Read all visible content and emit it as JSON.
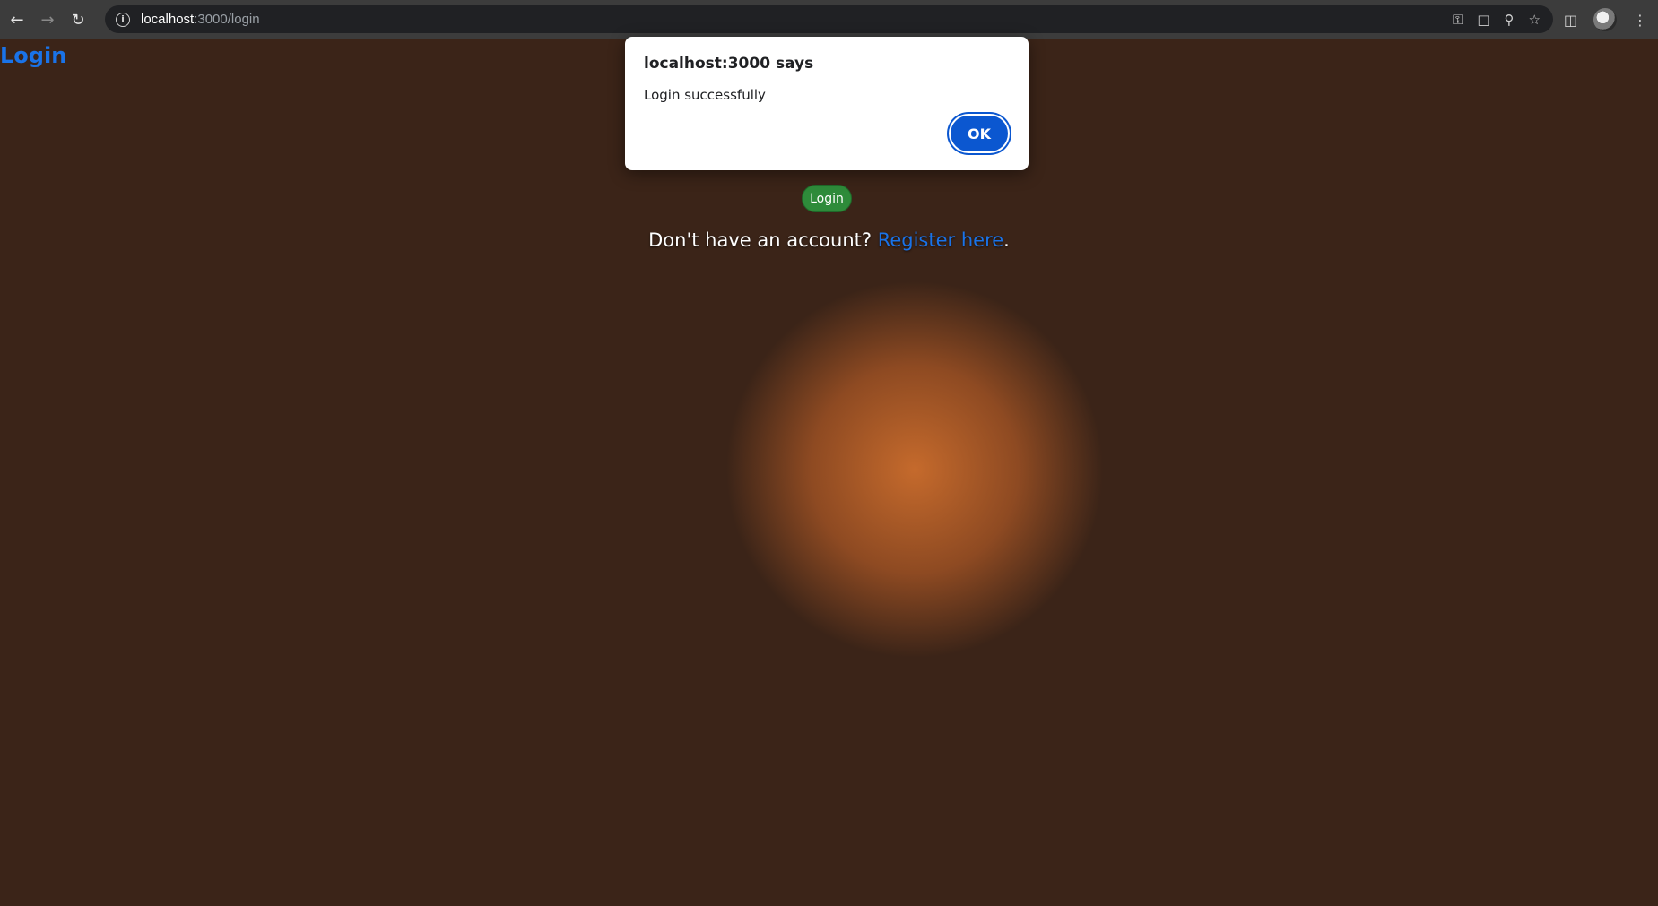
{
  "browser": {
    "url_host": "localhost",
    "url_rest": ":3000/login"
  },
  "page": {
    "title": "Login",
    "login_button": "Login",
    "register_prompt": "Don't have an account? ",
    "register_link": "Register here",
    "register_suffix": "."
  },
  "dialog": {
    "title": "localhost:3000 says",
    "message": "Login successfully",
    "ok_label": "OK"
  },
  "colors": {
    "link": "#1a73e8",
    "login_button": "#2e8b3a",
    "dialog_ok": "#0b57d0"
  }
}
